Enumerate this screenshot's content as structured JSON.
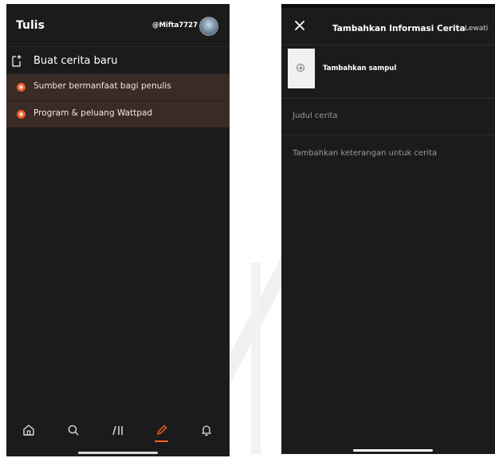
{
  "left_screen": {
    "header": {
      "title": "Tulis",
      "username": "@Mifta7727"
    },
    "new_story_label": "Buat cerita baru",
    "rows": [
      {
        "label": "Sumber bermanfaat bagi penulis",
        "icon": "resource-icon"
      },
      {
        "label": "Program & peluang Wattpad",
        "icon": "star-badge-icon"
      }
    ],
    "nav": [
      {
        "icon": "home-icon"
      },
      {
        "icon": "search-icon"
      },
      {
        "icon": "library-icon"
      },
      {
        "icon": "pencil-icon",
        "active": true
      },
      {
        "icon": "bell-icon"
      }
    ],
    "colors": {
      "accent": "#ff6122",
      "row_bg": "#3a2b27",
      "bg": "#1b1b1b"
    }
  },
  "right_screen": {
    "header": {
      "title": "Tambahkan Informasi Cerita",
      "skip_label": "Lewati"
    },
    "cover_label": "Tambahkan sampul",
    "title_placeholder": "Judul cerita",
    "description_placeholder": "Tambahkan keterangan untuk cerita"
  }
}
